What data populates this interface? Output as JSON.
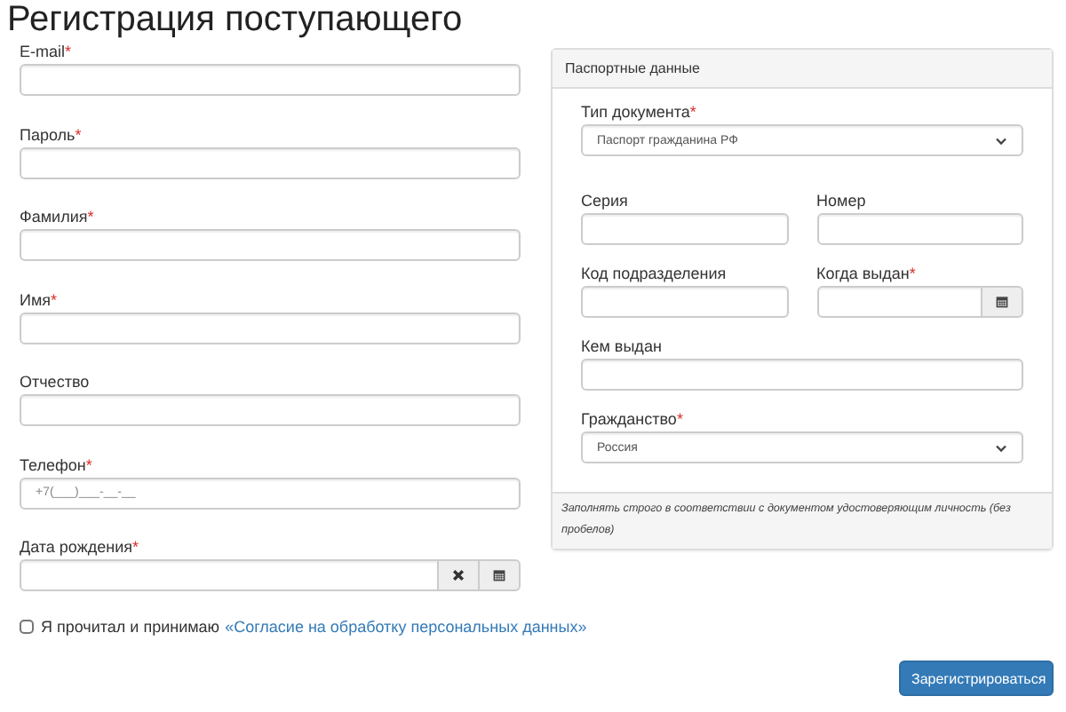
{
  "title": "Регистрация поступающего",
  "fields": [
    {
      "kind": "text",
      "label": "E-mail",
      "required_mark": "*"
    },
    {
      "kind": "text",
      "label": "Пароль",
      "required_mark": "*"
    },
    {
      "kind": "text",
      "label": "Фамилия",
      "required_mark": "*"
    },
    {
      "kind": "text",
      "label": "Имя",
      "required_mark": "*"
    },
    {
      "kind": "text",
      "label": "Отчество"
    },
    {
      "kind": "text",
      "label": "Телефон",
      "required_mark": "*",
      "placeholder": "+7(___)___-__-__"
    },
    {
      "kind": "date_clear",
      "label": "Дата рождения",
      "required_mark": "*"
    }
  ],
  "passport": {
    "title": "Паспортные данные",
    "rows": [
      [
        {
          "kind": "select",
          "label": "Тип документа",
          "required_mark": "*",
          "value": "Паспорт гражданина РФ"
        }
      ],
      [
        {
          "kind": "text",
          "label": "Серия"
        },
        {
          "kind": "text",
          "label": "Номер"
        }
      ],
      [
        {
          "kind": "text",
          "label": "Код подразделения"
        },
        {
          "kind": "date",
          "label": "Когда выдан",
          "required_mark": "*"
        }
      ],
      [
        {
          "kind": "text",
          "label": "Кем выдан"
        }
      ],
      [
        {
          "kind": "select",
          "label": "Гражданство",
          "required_mark": "*",
          "value": "Россия"
        }
      ]
    ],
    "note": "Заполнять строго в соответствии с документом удостоверяющим личность (без пробелов)"
  },
  "consent": {
    "checked": false,
    "text": "Я прочитал и принимаю",
    "link": "«Согласие на обработку персональных данных»"
  },
  "submit": "Зарегистрироваться"
}
